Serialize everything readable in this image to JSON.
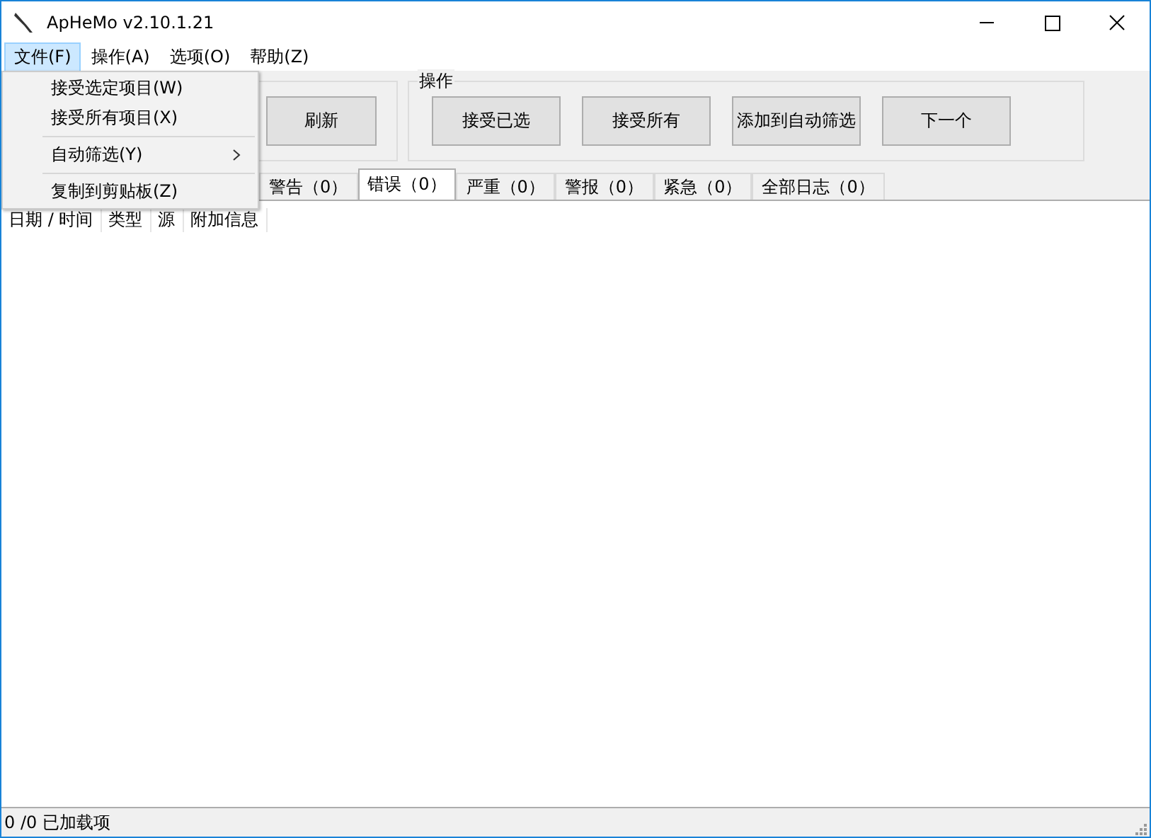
{
  "window": {
    "title": "ApHeMo v2.10.1.21"
  },
  "menu_bar": [
    {
      "label": "文件(F)",
      "selected": true
    },
    {
      "label": "操作(A)",
      "selected": false
    },
    {
      "label": "选项(O)",
      "selected": false
    },
    {
      "label": "帮助(Z)",
      "selected": false
    }
  ],
  "file_menu": [
    {
      "kind": "item",
      "label": "接受选定项目(W)",
      "submenu": false
    },
    {
      "kind": "item",
      "label": "接受所有项目(X)",
      "submenu": false
    },
    {
      "kind": "separator"
    },
    {
      "kind": "item",
      "label": "自动筛选(Y)",
      "submenu": true
    },
    {
      "kind": "separator"
    },
    {
      "kind": "item",
      "label": "复制到剪贴板(Z)",
      "submenu": false
    }
  ],
  "left_group": {
    "buttons": [
      "刷新"
    ]
  },
  "action_group": {
    "title": "操作",
    "buttons": [
      "接受已选",
      "接受所有",
      "添加到自动筛选",
      "下一个"
    ]
  },
  "tabs": [
    {
      "label": "警告（0）",
      "selected": false
    },
    {
      "label": "错误（0）",
      "selected": true
    },
    {
      "label": "严重（0）",
      "selected": false
    },
    {
      "label": "警报（0）",
      "selected": false
    },
    {
      "label": "紧急（0）",
      "selected": false
    },
    {
      "label": "全部日志（0）",
      "selected": false
    }
  ],
  "table": {
    "columns": [
      "日期 / 时间",
      "类型",
      "源",
      "附加信息"
    ]
  },
  "status_bar": "0 /0 已加载项"
}
